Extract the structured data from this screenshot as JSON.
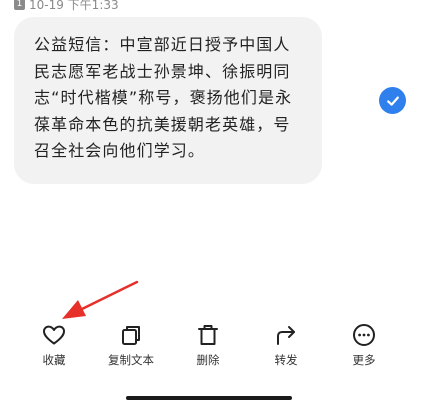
{
  "header": {
    "sim_badge": "1",
    "timestamp": "10-19 下午1:33"
  },
  "message": {
    "lines": [
      "公益短信：中宣部近日授予中国人",
      "民志愿军老战士孙景坤、徐振明同",
      "志“时代楷模”称号，褒扬他们是永",
      "葆革命本色的抗美援朝老英雄，号",
      "召全社会向他们学习。"
    ],
    "selected": true
  },
  "actions": [
    {
      "id": "favorite",
      "label": "收藏",
      "icon": "heart-icon"
    },
    {
      "id": "copy",
      "label": "复制文本",
      "icon": "copy-icon"
    },
    {
      "id": "delete",
      "label": "删除",
      "icon": "trash-icon"
    },
    {
      "id": "forward",
      "label": "转发",
      "icon": "forward-icon"
    },
    {
      "id": "more",
      "label": "更多",
      "icon": "more-icon"
    }
  ],
  "colors": {
    "accent": "#2f80ed",
    "annotation": "#e8302a",
    "bubble": "#f2f2f2"
  }
}
